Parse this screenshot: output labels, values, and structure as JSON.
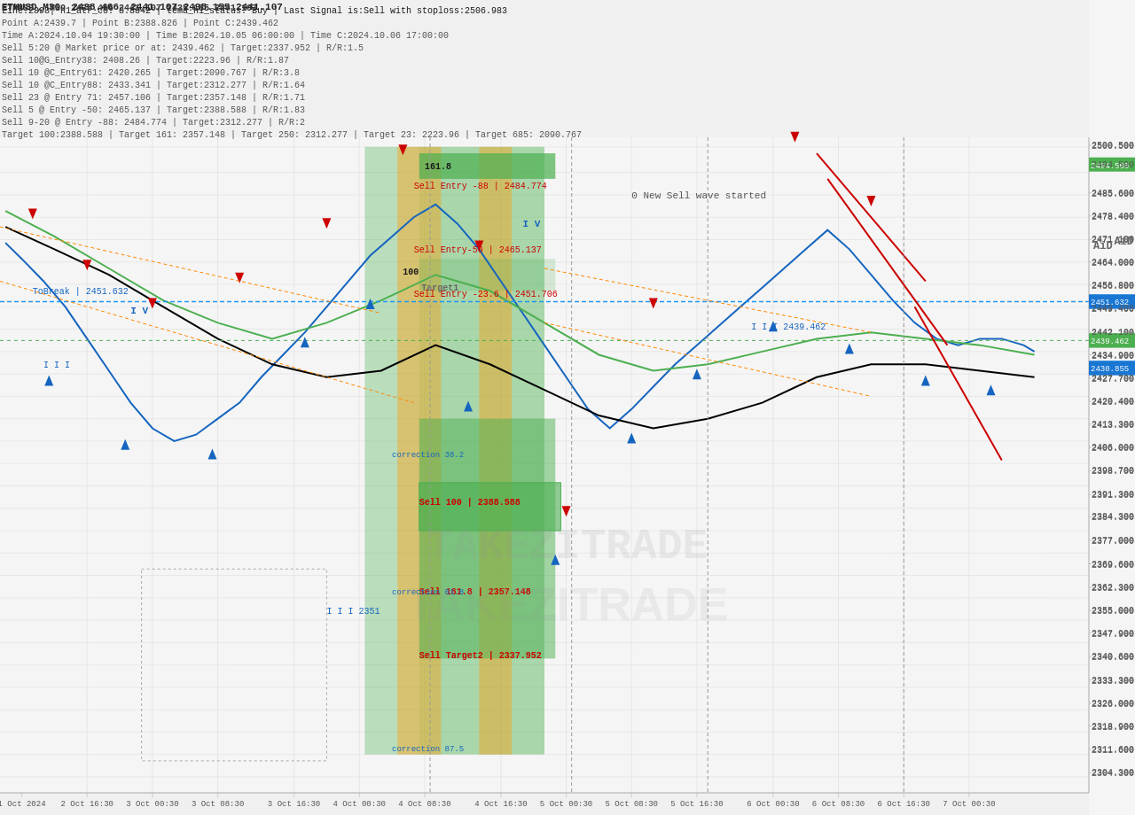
{
  "chart": {
    "symbol": "ETHUSD",
    "timeframe": "M30",
    "price_current": "2438.466",
    "price_values": "2441.107 2435.155 2441.107",
    "atr_c0": "8.8842",
    "tema_h1_status": "Buy",
    "last_signal": "Sell with stoploss:2506.983",
    "watermark": "TAKEZITRADE",
    "aid_label": "AiD"
  },
  "info_lines": [
    "Line:2898| h1_atr_c0: 8.8842 | tema_h1_status: Buy | Last Signal is:Sell with stoploss:2506.983",
    "Point A:2439.7 | Point B:2388.826 | Point C:2439.462",
    "Time A:2024.10.04 19:30:00 | Time B:2024.10.05 06:00:00 | Time C:2024.10.06 17:00:00",
    "Sell 5:20 @ Market price or at: 2439.462 | Target:2337.952 | R/R:1.5",
    "Sell 10@G_Entry38: 2408.26 | Target:2223.96 | R/R:1.87",
    "Sell 10 @C_Entry61: 2420.265 | Target:2090.767 | R/R:3.8",
    "Sell 10 @C_Entry88: 2433.341 | Target:2312.277 | R/R:1.64",
    "Sell 23 @ Entry 71: 2457.106 | Target:2357.148 | R/R:1.71",
    "Sell 5 @ Entry -50: 2465.137 | Target:2388.588 | R/R:1.83",
    "Sell 9-20 @ Entry -88: 2484.774 | Target:2312.277 | R/R:2",
    "Target 100:2388.588 | Target 161: 2357.148 | Target 250: 2312.277 | Target 23: 2223.96 | Target 685: 2090.767"
  ],
  "price_levels": {
    "top": 2500.5,
    "p2494_500": 2494.5,
    "p2485_605": 2485.605,
    "p2478_424": 2478.424,
    "p2471_110": 2471.11,
    "p2464_015": 2464.015,
    "p2456_750": 2456.75,
    "p2451_632": 2451.632,
    "p2449_395": 2449.395,
    "p2439_462": 2439.462,
    "p2434_990": 2434.99,
    "p2430_855": 2430.855,
    "p2427_680": 2427.68,
    "p2420_370": 2420.37,
    "p2413_275": 2413.275,
    "p2405_965": 2405.965,
    "p2398_655": 2398.655,
    "p2391_345": 2391.345,
    "p2384_250": 2384.25,
    "p2376_940": 2376.94,
    "p2369_630": 2369.63,
    "p2362_338": 2362.338,
    "p2355_028": 2355.028,
    "p2347_915": 2347.915,
    "p2340_605": 2340.605,
    "p2333_295": 2333.295,
    "p2326_000": 2326.0,
    "p2318_890": 2318.89,
    "p2311_580": 2311.58,
    "p2304_270": 2304.27
  },
  "annotations": {
    "tobreak": "ToBreak | 2451.632",
    "sell_entry_88": "Sell Entry -88 | 2484.774",
    "sell_entry_50": "Sell Entry-50 | 2465.137",
    "sell_entry_236": "Sell Entry -23.6 | 2451.706",
    "sell_100": "Sell 100 | 2388.588",
    "sell_161": "Sell 161.8 | 2357.148",
    "sell_target2": "Sell Target2 | 2337.952",
    "correction_382": "correction 38.2",
    "correction_618": "correction 61.8",
    "correction_875": "correction 87.5",
    "price_iii": "I I I 2439.462",
    "price_iii2": "I I I 2351.xxx",
    "new_sell_wave": "0 New Sell wave started",
    "fib_1618": "161.8",
    "fib_100": "100",
    "fib_target1": "Target1",
    "iv_label": "I V",
    "iv_label2": "I V"
  },
  "time_labels": [
    {
      "label": "1 Oct 2024",
      "x_pct": 2
    },
    {
      "label": "2 Oct 16:30",
      "x_pct": 8
    },
    {
      "label": "3 Oct 00:30",
      "x_pct": 14
    },
    {
      "label": "3 Oct 08:30",
      "x_pct": 20
    },
    {
      "label": "3 Oct 16:30",
      "x_pct": 27
    },
    {
      "label": "4 Oct 00:30",
      "x_pct": 33
    },
    {
      "label": "4 Oct 08:30",
      "x_pct": 39
    },
    {
      "label": "4 Oct 16:30",
      "x_pct": 46
    },
    {
      "label": "5 Oct 00:30",
      "x_pct": 52
    },
    {
      "label": "5 Oct 08:30",
      "x_pct": 58
    },
    {
      "label": "5 Oct 16:30",
      "x_pct": 64
    },
    {
      "label": "6 Oct 00:30",
      "x_pct": 71
    },
    {
      "label": "6 Oct 08:30",
      "x_pct": 77
    },
    {
      "label": "6 Oct 16:30",
      "x_pct": 83
    },
    {
      "label": "7 Oct 00:30",
      "x_pct": 89
    }
  ],
  "colors": {
    "background": "#f0f0f0",
    "grid": "#d0d0d0",
    "candle_bull": "#000000",
    "candle_bear": "#000000",
    "ema_blue": "#1565C0",
    "ema_green": "#4CAF50",
    "ema_black": "#000000",
    "highlight_blue": "#2196F3",
    "highlight_green": "#4CAF50",
    "highlight_red": "#f44336",
    "fib_zone_green": "#66BB6A",
    "fib_zone_orange": "#FFA726",
    "tobreak_blue": "#1976D2",
    "sell_red": "#f44336"
  }
}
